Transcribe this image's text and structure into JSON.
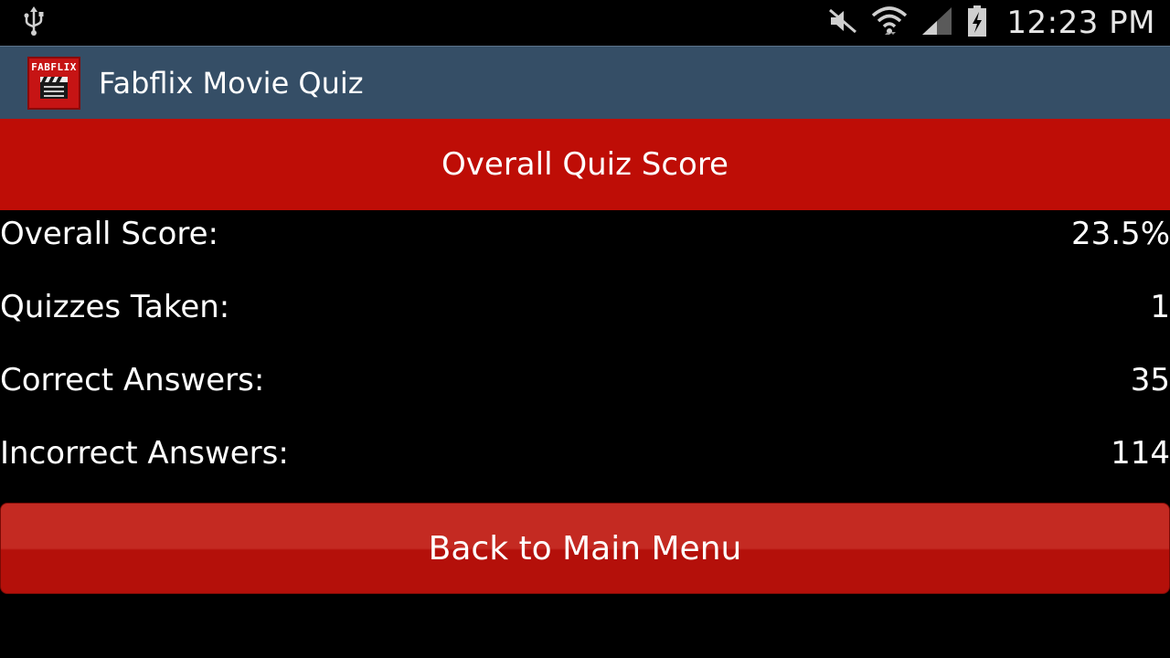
{
  "status_bar": {
    "time": "12:23 PM",
    "icons": [
      "usb-icon",
      "mute-icon",
      "wifi-icon",
      "signal-icon",
      "battery-charging-icon"
    ]
  },
  "action_bar": {
    "app_icon_text": "FABFLIX",
    "title": "Fabflix Movie Quiz"
  },
  "header": {
    "title": "Overall Quiz Score"
  },
  "stats": [
    {
      "label": "Overall Score:",
      "value": "23.5%"
    },
    {
      "label": "Quizzes Taken:",
      "value": "1"
    },
    {
      "label": "Correct Answers:",
      "value": "35"
    },
    {
      "label": "Incorrect Answers:",
      "value": "114"
    }
  ],
  "back_button": {
    "label": "Back to Main Menu"
  },
  "colors": {
    "status_bar_bg": "#000000",
    "action_bar_bg": "#354e66",
    "header_bg": "#be0d06",
    "button_bg": "#c42a22",
    "body_bg": "#000000"
  }
}
